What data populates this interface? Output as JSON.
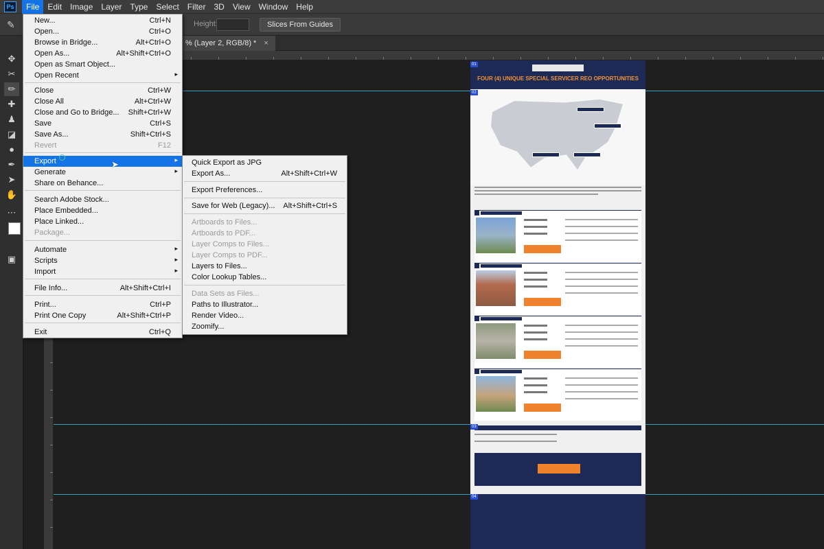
{
  "app": {
    "logo": "Ps"
  },
  "menubar": {
    "items": [
      "File",
      "Edit",
      "Image",
      "Layer",
      "Type",
      "Select",
      "Filter",
      "3D",
      "View",
      "Window",
      "Help"
    ]
  },
  "options": {
    "height_label": "Height:",
    "slices_button": "Slices From Guides"
  },
  "document_tab": {
    "title": "% (Layer 2, RGB/8) *",
    "close": "×"
  },
  "file_menu": {
    "items": [
      {
        "label": "New...",
        "shortcut": "Ctrl+N"
      },
      {
        "label": "Open...",
        "shortcut": "Ctrl+O"
      },
      {
        "label": "Browse in Bridge...",
        "shortcut": "Alt+Ctrl+O"
      },
      {
        "label": "Open As...",
        "shortcut": "Alt+Shift+Ctrl+O"
      },
      {
        "label": "Open as Smart Object..."
      },
      {
        "label": "Open Recent",
        "submenu": true
      },
      {
        "label": "Close",
        "shortcut": "Ctrl+W"
      },
      {
        "label": "Close All",
        "shortcut": "Alt+Ctrl+W"
      },
      {
        "label": "Close and Go to Bridge...",
        "shortcut": "Shift+Ctrl+W"
      },
      {
        "label": "Save",
        "shortcut": "Ctrl+S"
      },
      {
        "label": "Save As...",
        "shortcut": "Shift+Ctrl+S"
      },
      {
        "label": "Revert",
        "shortcut": "F12",
        "disabled": true
      },
      {
        "label": "Export",
        "submenu": true,
        "highlighted": true
      },
      {
        "label": "Generate",
        "submenu": true
      },
      {
        "label": "Share on Behance..."
      },
      {
        "label": "Search Adobe Stock..."
      },
      {
        "label": "Place Embedded..."
      },
      {
        "label": "Place Linked..."
      },
      {
        "label": "Package...",
        "disabled": true
      },
      {
        "label": "Automate",
        "submenu": true
      },
      {
        "label": "Scripts",
        "submenu": true
      },
      {
        "label": "Import",
        "submenu": true
      },
      {
        "label": "File Info...",
        "shortcut": "Alt+Shift+Ctrl+I"
      },
      {
        "label": "Print...",
        "shortcut": "Ctrl+P"
      },
      {
        "label": "Print One Copy",
        "shortcut": "Alt+Shift+Ctrl+P"
      },
      {
        "label": "Exit",
        "shortcut": "Ctrl+Q"
      }
    ]
  },
  "export_menu": {
    "items": [
      {
        "label": "Quick Export as JPG"
      },
      {
        "label": "Export As...",
        "shortcut": "Alt+Shift+Ctrl+W"
      },
      {
        "label": "Export Preferences..."
      },
      {
        "label": "Save for Web (Legacy)...",
        "shortcut": "Alt+Shift+Ctrl+S"
      },
      {
        "label": "Artboards to Files...",
        "disabled": true
      },
      {
        "label": "Artboards to PDF...",
        "disabled": true
      },
      {
        "label": "Layer Comps to Files...",
        "disabled": true
      },
      {
        "label": "Layer Comps to PDF...",
        "disabled": true
      },
      {
        "label": "Layers to Files..."
      },
      {
        "label": "Color Lookup Tables..."
      },
      {
        "label": "Data Sets as Files...",
        "disabled": true
      },
      {
        "label": "Paths to Illustrator..."
      },
      {
        "label": "Render Video..."
      },
      {
        "label": "Zoomify..."
      }
    ]
  },
  "document": {
    "title": "FOUR (4) UNIQUE SPECIAL SERVICER REO OPPORTUNITIES",
    "slice_tags": [
      "01",
      "02",
      "03",
      "04"
    ]
  }
}
